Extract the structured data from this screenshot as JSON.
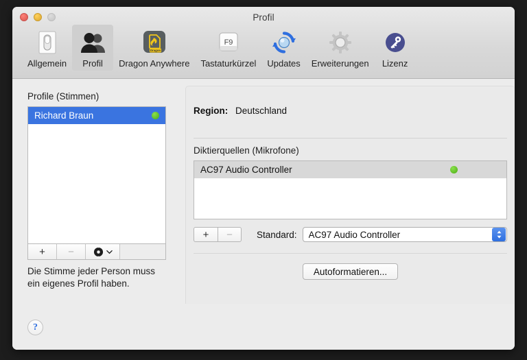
{
  "window": {
    "title": "Profil",
    "traffic_lights": [
      "close",
      "minimize",
      "zoom"
    ]
  },
  "toolbar": {
    "items": [
      {
        "label": "Allgemein",
        "icon": "toggle-switch-icon",
        "selected": false
      },
      {
        "label": "Profil",
        "icon": "two-people-icon",
        "selected": true
      },
      {
        "label": "Dragon Anywhere",
        "icon": "dragon-app-icon",
        "selected": false
      },
      {
        "label": "Tastaturkürzel",
        "icon": "f9-key-icon",
        "selected": false
      },
      {
        "label": "Updates",
        "icon": "refresh-globe-icon",
        "selected": false
      },
      {
        "label": "Erweiterungen",
        "icon": "gear-icon",
        "selected": false
      },
      {
        "label": "Lizenz",
        "icon": "key-circle-icon",
        "selected": false
      }
    ],
    "dragon_badge": "Dragon",
    "fkey_label": "F9"
  },
  "profiles": {
    "section_label": "Profile (Stimmen)",
    "rows": [
      {
        "name": "Richard Braun",
        "status": "active"
      }
    ],
    "buttons": {
      "add": "+",
      "remove": "−",
      "gear": "gear-icon",
      "gear_chevron": "chevron-down-icon"
    },
    "helper_text": "Die Stimme jeder Person muss ein eigenes Profil haben."
  },
  "detail": {
    "region_label": "Region:",
    "region_value": "Deutschland",
    "sources_label": "Diktierquellen (Mikrofone)",
    "sources": [
      {
        "name": "AC97 Audio Controller",
        "status": "active"
      }
    ],
    "source_buttons": {
      "add": "+",
      "remove": "−"
    },
    "default_label": "Standard:",
    "default_value": "AC97 Audio Controller",
    "autoformat_button": "Autoformatieren..."
  },
  "help": {
    "label": "?"
  },
  "colors": {
    "selection_blue": "#3a74e0",
    "status_green": "#6ec32a",
    "accent_blue": "#2f6fdf",
    "window_bg": "#ececec",
    "dragon_yellow": "#f2c619"
  }
}
